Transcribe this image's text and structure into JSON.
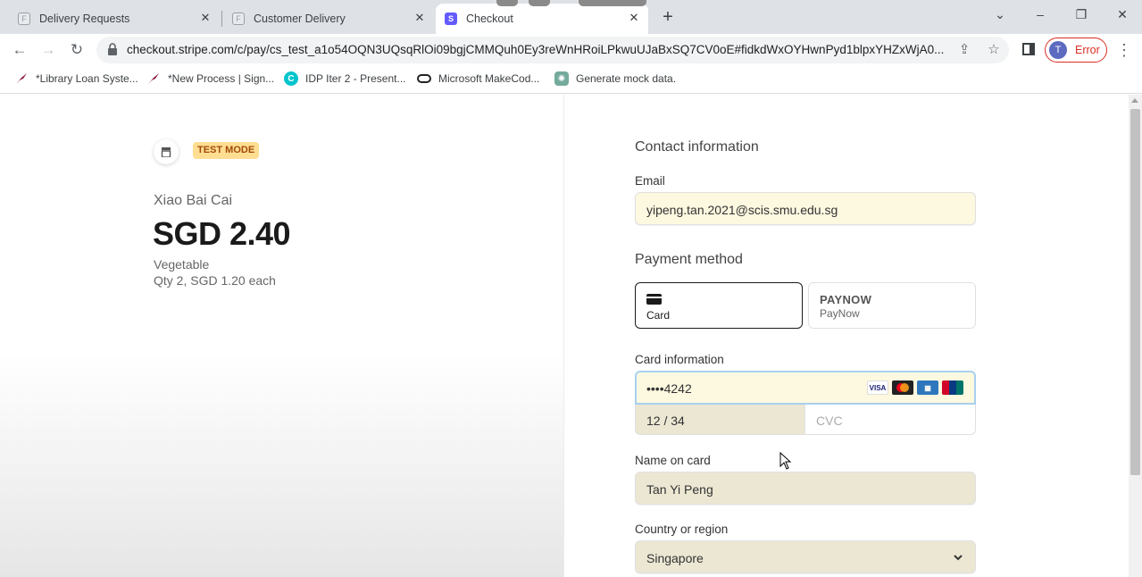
{
  "browser": {
    "tabs": [
      {
        "title": "Delivery Requests",
        "icon": "form-icon",
        "active": false
      },
      {
        "title": "Customer Delivery",
        "icon": "form-icon",
        "active": false
      },
      {
        "title": "Checkout",
        "icon": "stripe-icon",
        "active": true
      }
    ],
    "stripe_fav": "S",
    "form_fav": "F",
    "url": "checkout.stripe.com/c/pay/cs_test_a1o54OQN3UQsqRlOi09bgjCMMQuh0Ey3reWnHRoiLPkwuUJaBxSQ7CV0oE#fidkdWxOYHwnPyd1blpxYHZxWjA0...",
    "profile_initial": "T",
    "profile_status": "Error",
    "bookmarks": [
      {
        "label": "*Library Loan Syste...",
        "icon": "bird-icon"
      },
      {
        "label": "*New Process | Sign...",
        "icon": "bird-icon"
      },
      {
        "label": "IDP Iter 2 - Present...",
        "icon": "canva-icon"
      },
      {
        "label": "Microsoft MakeCod...",
        "icon": "makecode-icon"
      },
      {
        "label": "Generate mock data.",
        "icon": "chatgpt-icon"
      }
    ]
  },
  "summary": {
    "test_mode": "TEST MODE",
    "product_name": "Xiao Bai Cai",
    "price": "SGD 2.40",
    "description": "Vegetable",
    "quantity": "Qty 2, SGD 1.20 each"
  },
  "form": {
    "contact_title": "Contact information",
    "email_label": "Email",
    "email_value": "yipeng.tan.2021@scis.smu.edu.sg",
    "payment_title": "Payment method",
    "methods": [
      {
        "label": "Card",
        "selected": true,
        "icon": "card-icon"
      },
      {
        "label": "PayNow",
        "logo": "PAYNOW",
        "selected": false,
        "icon": "paynow-icon"
      }
    ],
    "card_info_label": "Card information",
    "card_number": "••••4242",
    "card_brands": [
      "VISA",
      "Mastercard",
      "AMEX",
      "UnionPay"
    ],
    "expiry": "12 / 34",
    "cvc_placeholder": "CVC",
    "name_label": "Name on card",
    "name_value": "Tan Yi Peng",
    "country_label": "Country or region",
    "country_value": "Singapore"
  },
  "colors": {
    "stripe_accent": "#635bff",
    "autofill_yellow": "#fdf8e0",
    "test_badge_bg": "#ffde92",
    "test_badge_text": "#a14c0b",
    "error_red": "#d93025"
  }
}
